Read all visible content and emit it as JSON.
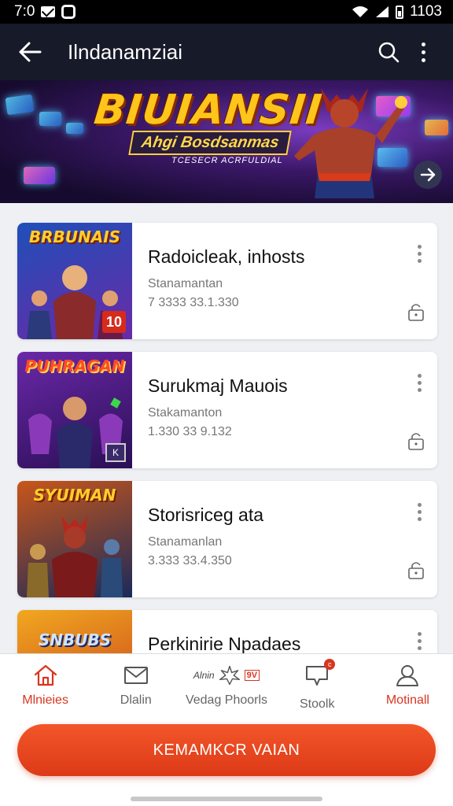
{
  "status_bar": {
    "time": "7:0",
    "right_time": "1103"
  },
  "app_bar": {
    "title": "Ilndanamziai"
  },
  "banner": {
    "title": "BIUIANSII",
    "subtitle": "Ahgi Bosdsanmas",
    "tagline": "TCESECR ACRFULDIAL"
  },
  "cards": [
    {
      "thumb_title": "BRBUNAIS",
      "thumb_badge": "10",
      "title": "Radoicleak, inhosts",
      "sub": "Stanamantan",
      "meta": "7 3333 33.1.330",
      "thumb_colors": [
        "#1f4fb8",
        "#6a2aa8"
      ]
    },
    {
      "thumb_title": "PUHRAGAN",
      "thumb_badge": "K",
      "title": "Surukmaj Mauois",
      "sub": "Stakamanton",
      "meta": "1.330 33 9.132",
      "thumb_colors": [
        "#6a28a8",
        "#2a0f55"
      ]
    },
    {
      "thumb_title": "SYUIMAN",
      "thumb_badge": "",
      "title": "Storisriceg ata",
      "sub": "Stanamanlan",
      "meta": "3.333 33.4.350",
      "thumb_colors": [
        "#c8561a",
        "#1a2a5a"
      ]
    },
    {
      "thumb_title": "SNBUBS",
      "thumb_badge": "",
      "title": "Perkinirie Npadaes",
      "sub": "",
      "meta": "",
      "thumb_colors": [
        "#f0a820",
        "#c83a1a"
      ]
    }
  ],
  "bottom_nav": {
    "items": [
      {
        "label": "Mlnieies",
        "icon": "home-icon",
        "active": true
      },
      {
        "label": "Dlalin",
        "icon": "mail-icon",
        "active": false
      },
      {
        "label": "Vedag Phoorls",
        "icon": "sparkle-icon",
        "script": "Alnin",
        "badge": "9V",
        "active": false
      },
      {
        "label": "Stoolk",
        "icon": "chat-icon",
        "dot": "c",
        "active": false
      },
      {
        "label": "Motinall",
        "icon": "profile-icon",
        "active": true
      }
    ]
  },
  "cta": {
    "label": "KEMAMKCR VAIAN"
  },
  "colors": {
    "accent": "#dc3a17",
    "appbar": "#171a28"
  }
}
